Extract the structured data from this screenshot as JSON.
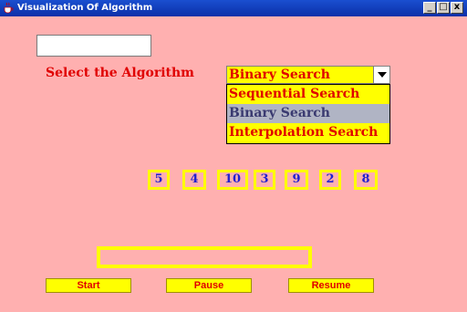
{
  "window": {
    "title": "Visualization Of Algorithm",
    "minimize": "_",
    "maximize": "□",
    "close": "x"
  },
  "form": {
    "text_value": "",
    "select_label": "Select the Algorithm",
    "combo_value": "Binary Search",
    "options": [
      "Sequential Search",
      "Binary Search",
      "Interpolation Search"
    ],
    "selected_option": "Binary Search"
  },
  "array_values": [
    "5",
    "4",
    "10",
    "3",
    "9",
    "2",
    "8"
  ],
  "buttons": {
    "start": "Start",
    "pause": "Pause",
    "resume": "Resume"
  },
  "colors": {
    "background": "#ffb0b0",
    "accent": "#ffff00",
    "label": "#e00000",
    "number": "#2020d0"
  }
}
